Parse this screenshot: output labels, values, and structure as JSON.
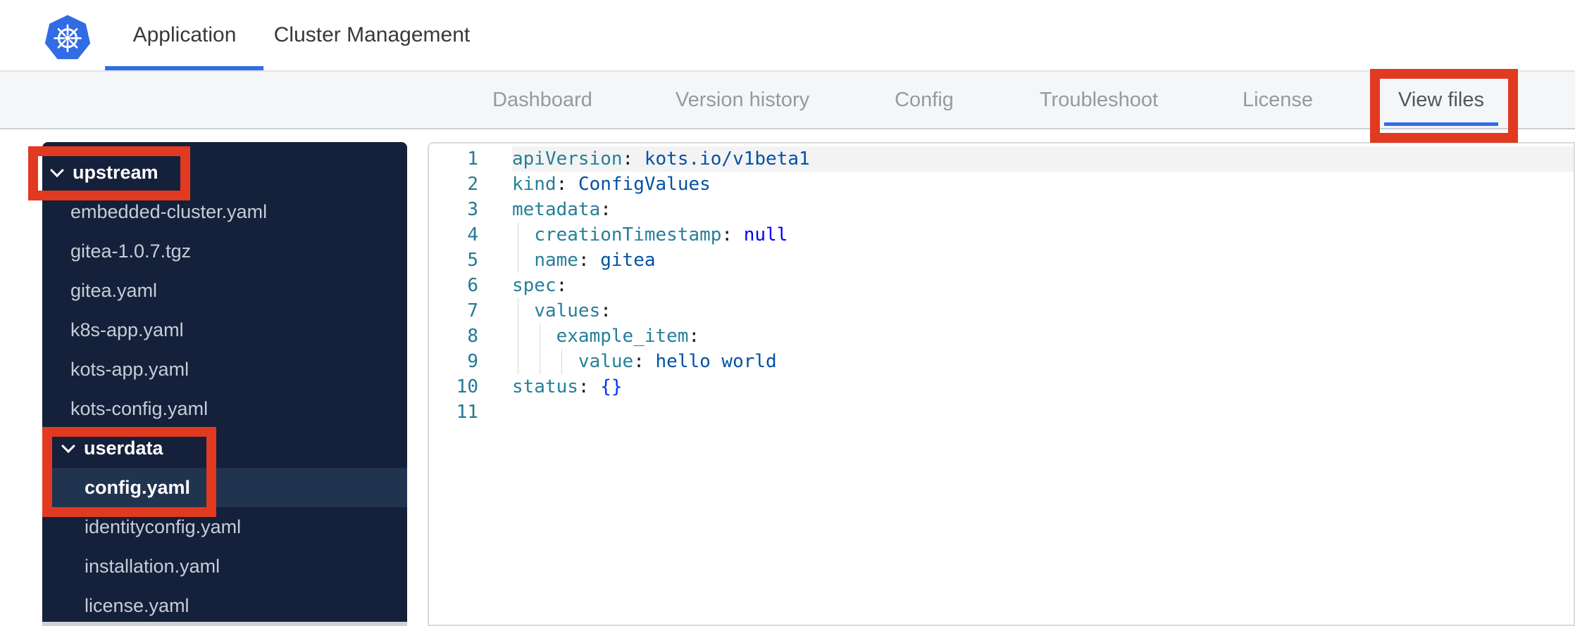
{
  "header": {
    "logo": "kubernetes-logo",
    "tabs": [
      {
        "label": "Application",
        "active": true
      },
      {
        "label": "Cluster Management",
        "active": false
      }
    ]
  },
  "nav": {
    "tabs": [
      {
        "label": "Dashboard",
        "active": false
      },
      {
        "label": "Version history",
        "active": false
      },
      {
        "label": "Config",
        "active": false
      },
      {
        "label": "Troubleshoot",
        "active": false
      },
      {
        "label": "License",
        "active": false
      },
      {
        "label": "View files",
        "active": true,
        "annotated": true
      }
    ]
  },
  "sidebar": {
    "items": [
      {
        "label": "upstream",
        "type": "folder",
        "level": 1,
        "expanded": true,
        "annotated": true
      },
      {
        "label": "embedded-cluster.yaml",
        "type": "file",
        "level": 1
      },
      {
        "label": "gitea-1.0.7.tgz",
        "type": "file",
        "level": 1
      },
      {
        "label": "gitea.yaml",
        "type": "file",
        "level": 1
      },
      {
        "label": "k8s-app.yaml",
        "type": "file",
        "level": 1
      },
      {
        "label": "kots-app.yaml",
        "type": "file",
        "level": 1
      },
      {
        "label": "kots-config.yaml",
        "type": "file",
        "level": 1
      },
      {
        "label": "userdata",
        "type": "folder",
        "level": 2,
        "expanded": true,
        "annotated": true
      },
      {
        "label": "config.yaml",
        "type": "file",
        "level": 2,
        "selected": true,
        "annotated": true
      },
      {
        "label": "identityconfig.yaml",
        "type": "file",
        "level": 2
      },
      {
        "label": "installation.yaml",
        "type": "file",
        "level": 2
      },
      {
        "label": "license.yaml",
        "type": "file",
        "level": 2
      }
    ]
  },
  "editor": {
    "file": "config.yaml",
    "lines": [
      {
        "num": "1",
        "highlight": true,
        "guides": 0,
        "tokens": [
          [
            "key",
            "apiVersion"
          ],
          [
            "pun",
            ": "
          ],
          [
            "str",
            "kots.io/v1beta1"
          ]
        ]
      },
      {
        "num": "2",
        "guides": 0,
        "tokens": [
          [
            "key",
            "kind"
          ],
          [
            "pun",
            ": "
          ],
          [
            "str",
            "ConfigValues"
          ]
        ]
      },
      {
        "num": "3",
        "guides": 0,
        "tokens": [
          [
            "key",
            "metadata"
          ],
          [
            "pun",
            ":"
          ]
        ]
      },
      {
        "num": "4",
        "guides": 1,
        "tokens": [
          [
            "sp",
            "  "
          ],
          [
            "key",
            "creationTimestamp"
          ],
          [
            "pun",
            ": "
          ],
          [
            "kw",
            "null"
          ]
        ]
      },
      {
        "num": "5",
        "guides": 1,
        "tokens": [
          [
            "sp",
            "  "
          ],
          [
            "key",
            "name"
          ],
          [
            "pun",
            ": "
          ],
          [
            "str",
            "gitea"
          ]
        ]
      },
      {
        "num": "6",
        "guides": 0,
        "tokens": [
          [
            "key",
            "spec"
          ],
          [
            "pun",
            ":"
          ]
        ]
      },
      {
        "num": "7",
        "guides": 1,
        "tokens": [
          [
            "sp",
            "  "
          ],
          [
            "key",
            "values"
          ],
          [
            "pun",
            ":"
          ]
        ]
      },
      {
        "num": "8",
        "guides": 2,
        "tokens": [
          [
            "sp",
            "    "
          ],
          [
            "key",
            "example_item"
          ],
          [
            "pun",
            ":"
          ]
        ]
      },
      {
        "num": "9",
        "guides": 3,
        "tokens": [
          [
            "sp",
            "      "
          ],
          [
            "key",
            "value"
          ],
          [
            "pun",
            ": "
          ],
          [
            "str",
            "hello world"
          ]
        ]
      },
      {
        "num": "10",
        "guides": 0,
        "tokens": [
          [
            "key",
            "status"
          ],
          [
            "pun",
            ": "
          ],
          [
            "br",
            "{}"
          ]
        ]
      },
      {
        "num": "11",
        "guides": 0,
        "tokens": []
      }
    ]
  },
  "annotations": [
    {
      "target": "upstream-folder"
    },
    {
      "target": "userdata-and-config-yaml"
    },
    {
      "target": "view-files-tab"
    }
  ],
  "colors": {
    "kubernetes_blue": "#326CE5",
    "accent_underline_blue": "#326DE6",
    "annotation_red": "#E13A20",
    "sidebar_bg": "#15203A",
    "sidebar_selected_bg": "#20334F",
    "yaml_key": "#267F99",
    "yaml_string": "#0451A5",
    "yaml_keyword": "#0000FF",
    "yaml_bracket": "#0431FA",
    "line_number": "#237893"
  }
}
